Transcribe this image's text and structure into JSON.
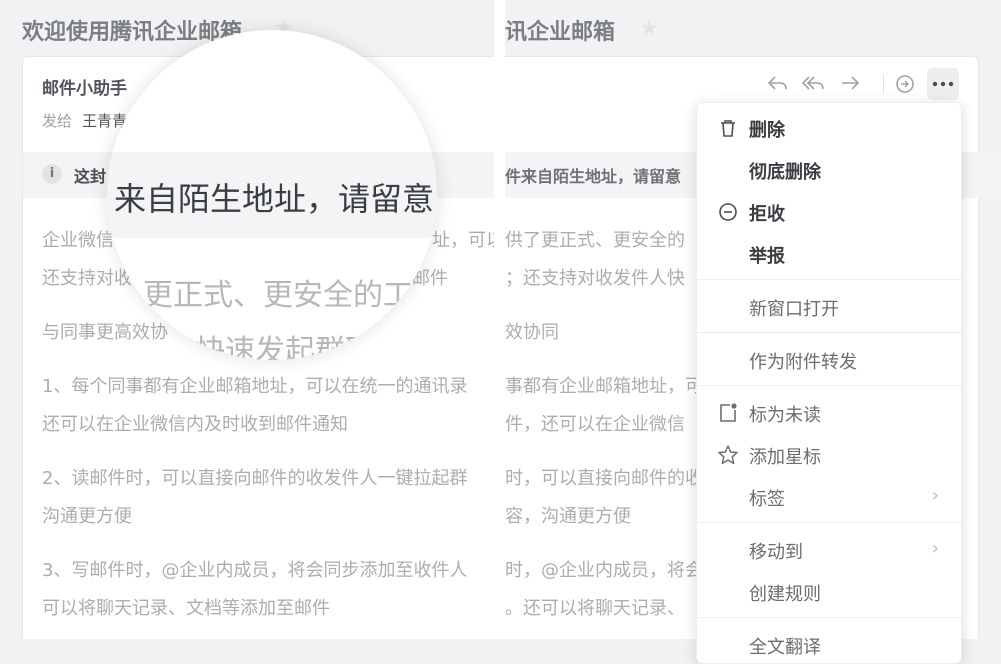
{
  "left_pane": {
    "title": "欢迎使用腾讯企业邮箱",
    "sender": "邮件小助手",
    "to_label": "发给",
    "to_name": "王青青",
    "warning": "这封",
    "body_lines": [
      "企业微信",
      "还支持对收",
      "与同事更高效协",
      "1、每个同事都有企业邮箱地址，可以在统一的通讯录",
      "还可以在企业微信内及时收到邮件通知",
      "2、读邮件时，可以直接向邮件的收发件人一键拉起群",
      "沟通更方便",
      "3、写邮件时，@企业内成员，将会同步添加至收件人",
      "可以将聊天记录、文档等添加至邮件"
    ],
    "body_frag_1": "址，可以",
    "body_frag_2": "邮件"
  },
  "right_pane": {
    "title": "讯企业邮箱",
    "warning": "件来自陌生地址，请留意",
    "body_lines": [
      "供了更正式、更安全的",
      "；还支持对收发件人快",
      "效协同",
      "事都有企业邮箱地址，可",
      "件，还可以在企业微信",
      "时，可以直接向邮件的收",
      "容，沟通更方便",
      "时，@企业内成员，将会",
      "。还可以将聊天记录、"
    ]
  },
  "magnifier": {
    "zoom_text": "来自陌生地址，请留意",
    "zoom_line1": "更正式、更安全的工",
    "zoom_line2": "快速发起群聊"
  },
  "toolbar": {
    "icons": [
      "reply-icon",
      "reply-all-icon",
      "forward-icon",
      "chat-icon",
      "more-icon"
    ]
  },
  "menu": {
    "items": [
      {
        "label": "删除",
        "icon": "trash-icon"
      },
      {
        "label": "彻底删除"
      },
      {
        "label": "拒收",
        "icon": "block-icon"
      },
      {
        "label": "举报"
      },
      {
        "label": "新窗口打开"
      },
      {
        "label": "作为附件转发"
      },
      {
        "label": "标为未读",
        "icon": "unread-icon"
      },
      {
        "label": "添加星标",
        "icon": "star-icon"
      },
      {
        "label": "标签"
      },
      {
        "label": "移动到"
      },
      {
        "label": "创建规则"
      },
      {
        "label": "全文翻译"
      }
    ]
  }
}
